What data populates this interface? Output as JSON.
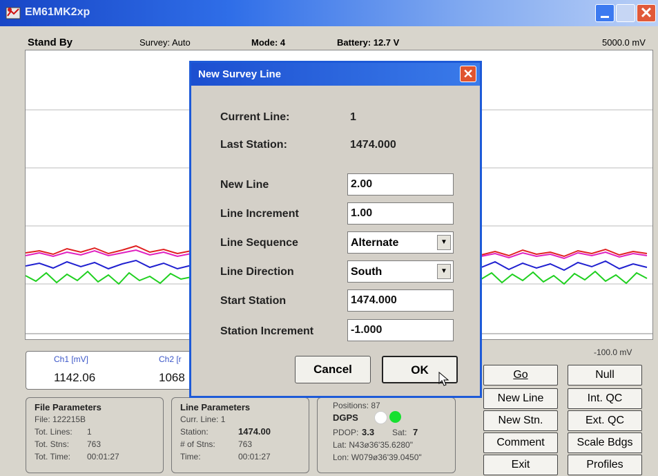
{
  "window": {
    "title": "EM61MK2xp"
  },
  "status": {
    "state": "Stand By",
    "survey": "Survey: Auto",
    "mode": "Mode: 4",
    "battery": "Battery: 12.7 V",
    "scale_top": "5000.0 mV",
    "scale_bottom": "-100.0 mV"
  },
  "channels": {
    "ch1_label": "Ch1 [mV]",
    "ch1_value": "1142.06",
    "ch2_label": "Ch2 [r",
    "ch2_value": "1068"
  },
  "file_params": {
    "title": "File Parameters",
    "file": "File: 122215B",
    "tot_lines_label": "Tot. Lines:",
    "tot_lines": "1",
    "tot_stns_label": "Tot. Stns:",
    "tot_stns": "763",
    "tot_time_label": "Tot. Time:",
    "tot_time": "00:01:27"
  },
  "line_params": {
    "title": "Line Parameters",
    "curr_line": "Curr. Line: 1",
    "station_label": "Station:",
    "station": "1474.00",
    "num_stns_label": "# of Stns:",
    "num_stns": "763",
    "time_label": "Time:",
    "time": "00:01:27"
  },
  "gps": {
    "positions": "Positions: 87",
    "dgps": "DGPS",
    "pdop_label": "PDOP:",
    "pdop": "3.3",
    "sat_label": "Sat:",
    "sat": "7",
    "lat": "Lat: N43ø36'35.6280\"",
    "lon": "Lon: W079ø36'39.0450\""
  },
  "buttons": {
    "go": "Go",
    "null": "Null",
    "new_line": "New Line",
    "int_qc": "Int. QC",
    "new_stn": "New Stn.",
    "ext_qc": "Ext. QC",
    "comment": "Comment",
    "scale_bdgs": "Scale Bdgs",
    "exit": "Exit",
    "profiles": "Profiles"
  },
  "dialog": {
    "title": "New Survey Line",
    "current_line_label": "Current Line:",
    "current_line": "1",
    "last_station_label": "Last Station:",
    "last_station": "1474.000",
    "new_line_label": "New Line",
    "new_line": "2.00",
    "line_increment_label": "Line Increment",
    "line_increment": "1.00",
    "line_sequence_label": "Line Sequence",
    "line_sequence": "Alternate",
    "line_direction_label": "Line Direction",
    "line_direction": "South",
    "start_station_label": "Start Station",
    "start_station": "1474.000",
    "station_increment_label": "Station Increment",
    "station_increment": "-1.000",
    "cancel": "Cancel",
    "ok": "OK"
  },
  "colors": {
    "trace_red": "#e02020",
    "trace_magenta": "#e020c0",
    "trace_blue": "#2020d0",
    "trace_green": "#20d020",
    "title_blue": "#1d5ad8",
    "gps_green": "#16e030"
  }
}
